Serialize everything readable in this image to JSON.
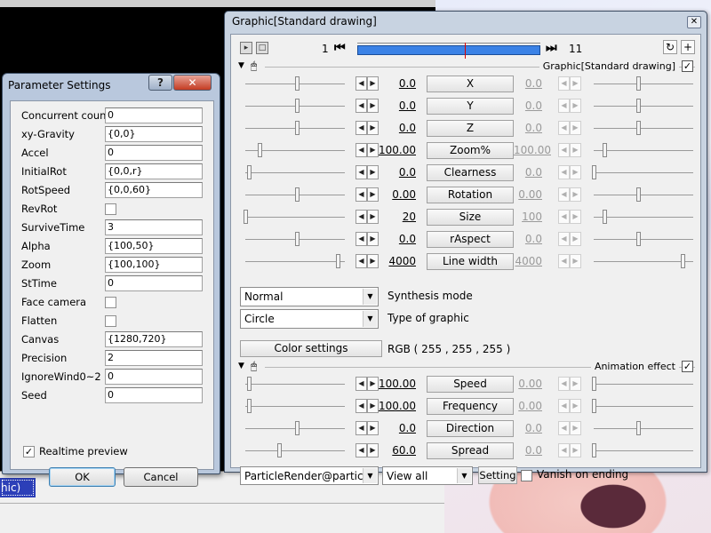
{
  "param_dialog": {
    "title": "Parameter Settings",
    "help_label": "?",
    "close_label": "✕",
    "rows": [
      {
        "label": "Concurrent count",
        "value": "0",
        "kind": "text"
      },
      {
        "label": "xy-Gravity",
        "value": "{0,0}",
        "kind": "text"
      },
      {
        "label": "Accel",
        "value": "0",
        "kind": "text"
      },
      {
        "label": "InitialRot",
        "value": "{0,0,r}",
        "kind": "text"
      },
      {
        "label": "RotSpeed",
        "value": "{0,0,60}",
        "kind": "text"
      },
      {
        "label": "RevRot",
        "value": "",
        "kind": "check"
      },
      {
        "label": "SurviveTime",
        "value": "3",
        "kind": "text"
      },
      {
        "label": "Alpha",
        "value": "{100,50}",
        "kind": "text"
      },
      {
        "label": "Zoom",
        "value": "{100,100}",
        "kind": "text"
      },
      {
        "label": "StTime",
        "value": "0",
        "kind": "text"
      },
      {
        "label": "Face camera",
        "value": "",
        "kind": "check"
      },
      {
        "label": "Flatten",
        "value": "",
        "kind": "check"
      },
      {
        "label": "Canvas",
        "value": "{1280,720}",
        "kind": "text"
      },
      {
        "label": "Precision",
        "value": "2",
        "kind": "text"
      },
      {
        "label": "IgnoreWind0~2",
        "value": "0",
        "kind": "text"
      },
      {
        "label": "Seed",
        "value": "0",
        "kind": "text"
      }
    ],
    "realtime_label": "Realtime preview",
    "realtime_checked_mark": "✓",
    "ok_label": "OK",
    "cancel_label": "Cancel"
  },
  "graphic_window": {
    "title": "Graphic[Standard drawing]",
    "close_label": "✕",
    "frame_start": "1",
    "frame_end": "11",
    "prev_label": "⏮",
    "next_label": "⏭",
    "section1_label": "Graphic[Standard drawing]",
    "section1_check": "✓",
    "tracks": [
      {
        "name": "X",
        "left": "0.0",
        "right": "0.0"
      },
      {
        "name": "Y",
        "left": "0.0",
        "right": "0.0"
      },
      {
        "name": "Z",
        "left": "0.0",
        "right": "0.0"
      },
      {
        "name": "Zoom%",
        "left": "100.00",
        "right": "100.00"
      },
      {
        "name": "Clearness",
        "left": "0.0",
        "right": "0.0"
      },
      {
        "name": "Rotation",
        "left": "0.00",
        "right": "0.00"
      },
      {
        "name": "Size",
        "left": "20",
        "right": "100"
      },
      {
        "name": "rAspect",
        "left": "0.0",
        "right": "0.0"
      },
      {
        "name": "Line width",
        "left": "4000",
        "right": "4000"
      }
    ],
    "synthesis_value": "Normal",
    "synthesis_label": "Synthesis mode",
    "graphic_type_value": "Circle",
    "graphic_type_label": "Type of graphic",
    "color_button_label": "Color settings",
    "rgb_label": "RGB ( 255 , 255 , 255 )",
    "section2_label": "Animation effect",
    "section2_check": "✓",
    "anim_tracks": [
      {
        "name": "Speed",
        "left": "100.00",
        "right": "0.00"
      },
      {
        "name": "Frequency",
        "left": "100.00",
        "right": "0.00"
      },
      {
        "name": "Direction",
        "left": "0.0",
        "right": "0.0"
      },
      {
        "name": "Spread",
        "left": "60.0",
        "right": "0.0"
      }
    ],
    "effect_select": "ParticleRender@particle",
    "view_select": "View all",
    "setting_label": "Setting",
    "vanish_label": "Vanish on ending"
  },
  "background": {
    "selected_item_text": "hic)"
  }
}
